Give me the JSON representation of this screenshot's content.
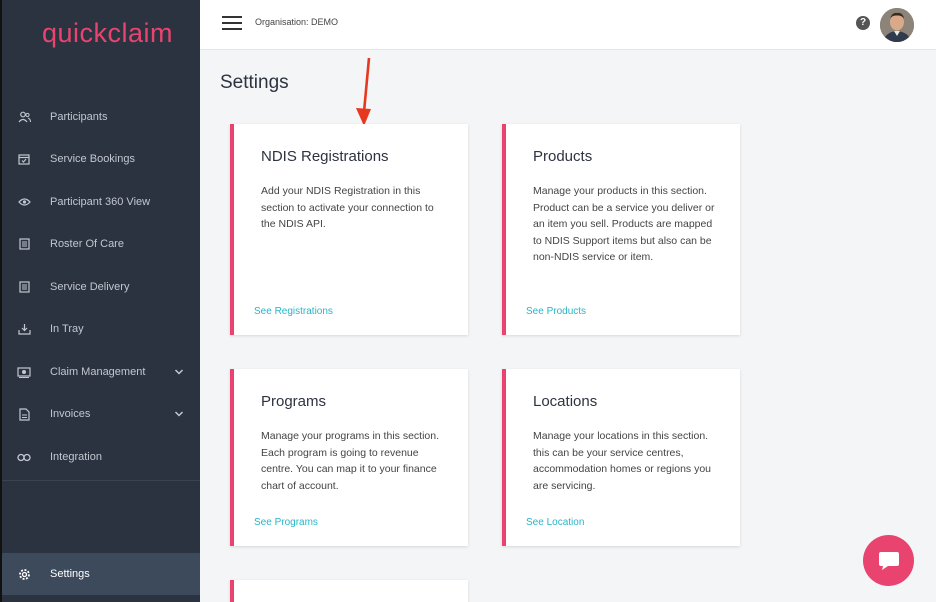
{
  "app": {
    "logo_text": "quickclaim"
  },
  "colors": {
    "accent": "#e8446f",
    "link": "#27b5c8",
    "sidebar_bg": "#2b3340"
  },
  "header": {
    "organisation": "Organisation: DEMO",
    "help_icon": "?"
  },
  "sidebar": {
    "items": [
      {
        "label": "Participants",
        "icon": "users-icon"
      },
      {
        "label": "Service Bookings",
        "icon": "calendar-check-icon"
      },
      {
        "label": "Participant 360 View",
        "icon": "eye-icon"
      },
      {
        "label": "Roster Of Care",
        "icon": "list-icon"
      },
      {
        "label": "Service Delivery",
        "icon": "list-icon"
      },
      {
        "label": "In Tray",
        "icon": "download-icon"
      },
      {
        "label": "Claim Management",
        "icon": "money-icon",
        "expandable": true
      },
      {
        "label": "Invoices",
        "icon": "file-icon",
        "expandable": true
      },
      {
        "label": "Integration",
        "icon": "link-icon"
      },
      {
        "label": "Settings",
        "icon": "gear-icon",
        "active": true
      }
    ]
  },
  "main": {
    "title": "Settings",
    "cards": [
      {
        "title": "NDIS Registrations",
        "description": "Add your NDIS Registration in this section to activate your connection to the NDIS API.",
        "link": "See Registrations"
      },
      {
        "title": "Products",
        "description": "Manage your products in this section. Product can be a service you deliver or an item you sell. Products are mapped to NDIS Support items but also can be non-NDIS service or item.",
        "link": "See Products"
      },
      {
        "title": "Programs",
        "description": "Manage your programs in this section. Each program is going to revenue centre. You can map it to your finance chart of account.",
        "link": "See Programs"
      },
      {
        "title": "Locations",
        "description": "Manage your locations in this section. this can be your service centres, accommodation homes or regions you are servicing.",
        "link": "See Location"
      }
    ]
  }
}
